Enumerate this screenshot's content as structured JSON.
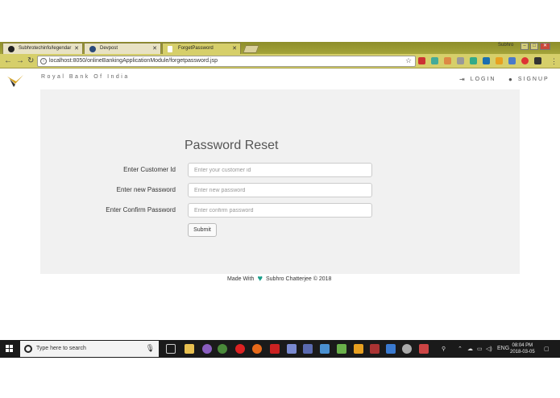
{
  "browser": {
    "tabs": [
      {
        "label": "Subhrotechinfo/legendar",
        "active": false
      },
      {
        "label": "Devpost",
        "active": false
      },
      {
        "label": "ForgetPassword",
        "active": true
      }
    ],
    "window_user": "Subhro",
    "url": "localhost:8050/onlineBankingApplicationModule/forgetpassword.jsp"
  },
  "header": {
    "brand": "Royal Bank Of India",
    "login": "LOGIN",
    "signup": "SIGNUP"
  },
  "form": {
    "title": "Password Reset",
    "customer_id": {
      "label": "Enter Customer Id",
      "placeholder": "Enter your customer id"
    },
    "new_password": {
      "label": "Enter new Password",
      "placeholder": "Enter new password"
    },
    "confirm_password": {
      "label": "Enter Confirm Password",
      "placeholder": "Enter confirm password"
    },
    "submit": "Submit"
  },
  "footer": {
    "made_with": "Made With",
    "author": "Subhro Chatterjee © 2018"
  },
  "taskbar": {
    "search_placeholder": "Type here to search",
    "language": "ENG",
    "time": "08:04 PM",
    "date": "2018-03-05"
  },
  "colors": {
    "chrome_theme": "#d6cf6a",
    "panel_bg": "#f1f1f1",
    "heart": "#1a9e8a"
  }
}
